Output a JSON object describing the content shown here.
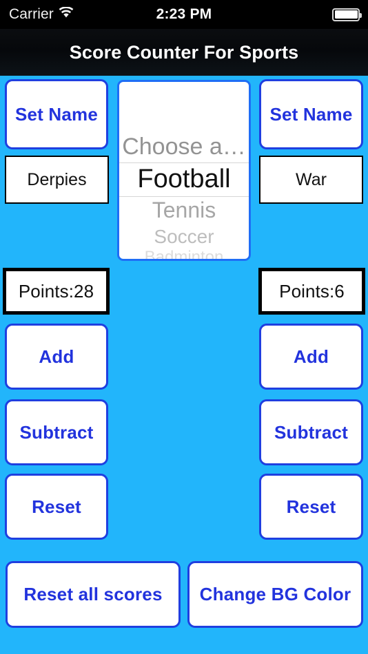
{
  "status_bar": {
    "carrier": "Carrier",
    "wifi_icon": "wifi-icon",
    "time": "2:23 PM",
    "battery_icon": "battery-full-icon"
  },
  "nav": {
    "title": "Score Counter For Sports"
  },
  "theme": {
    "background": "#22b5fb",
    "button_text": "#2233dd",
    "button_border": "#1f3fe0",
    "picker_border": "#1f6ef5",
    "box_border": "#000000",
    "nav_background": "#0a0c10"
  },
  "picker": {
    "items": [
      {
        "label": "Choose a…",
        "state": "above"
      },
      {
        "label": "Football",
        "state": "selected"
      },
      {
        "label": "Tennis",
        "state": "below"
      },
      {
        "label": "Soccer",
        "state": "below"
      },
      {
        "label": "Badminton",
        "state": "below"
      }
    ],
    "selected_value": "Football"
  },
  "team_left": {
    "set_name_label": "Set Name",
    "name_value": "Derpies",
    "points_label": "Points:28",
    "add_label": "Add",
    "subtract_label": "Subtract",
    "reset_label": "Reset"
  },
  "team_right": {
    "set_name_label": "Set Name",
    "name_value": "War",
    "points_label": "Points:6",
    "add_label": "Add",
    "subtract_label": "Subtract",
    "reset_label": "Reset"
  },
  "footer": {
    "reset_all_label": "Reset all scores",
    "change_bg_label": "Change BG Color"
  }
}
